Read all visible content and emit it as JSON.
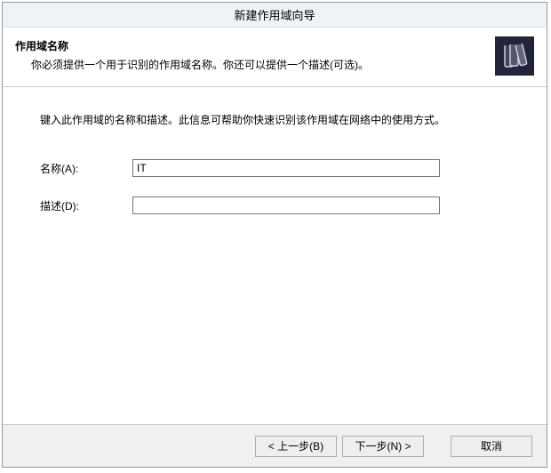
{
  "window": {
    "title": "新建作用域向导"
  },
  "header": {
    "title": "作用域名称",
    "subtitle": "你必须提供一个用于识别的作用域名称。你还可以提供一个描述(可选)。"
  },
  "content": {
    "instruction": "键入此作用域的名称和描述。此信息可帮助你快速识别该作用域在网络中的使用方式。",
    "name_label": "名称(A):",
    "name_value": "IT",
    "desc_label": "描述(D):",
    "desc_value": ""
  },
  "footer": {
    "back": "< 上一步(B)",
    "next": "下一步(N) >",
    "cancel": "取消"
  },
  "colors": {
    "titlebar_bg": "#eef3f8",
    "footer_bg": "#f0f0f0",
    "icon_bg": "#23233a"
  }
}
